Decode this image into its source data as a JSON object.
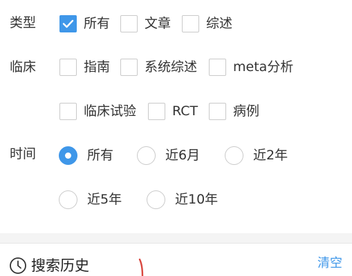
{
  "filters": {
    "type": {
      "label": "类型",
      "options": [
        {
          "label": "所有",
          "checked": true
        },
        {
          "label": "文章",
          "checked": false
        },
        {
          "label": "综述",
          "checked": false
        }
      ]
    },
    "clinical": {
      "label": "临床",
      "options": [
        {
          "label": "指南",
          "checked": false
        },
        {
          "label": "系统综述",
          "checked": false
        },
        {
          "label": "meta分析",
          "checked": false
        },
        {
          "label": "临床试验",
          "checked": false
        },
        {
          "label": "RCT",
          "checked": false
        },
        {
          "label": "病例",
          "checked": false
        }
      ]
    },
    "time": {
      "label": "时间",
      "options": [
        {
          "label": "所有",
          "selected": true
        },
        {
          "label": "近6月",
          "selected": false
        },
        {
          "label": "近2年",
          "selected": false
        },
        {
          "label": "近5年",
          "selected": false
        },
        {
          "label": "近10年",
          "selected": false
        }
      ]
    }
  },
  "history": {
    "title": "搜索历史",
    "clear_label": "清空",
    "icon": "clock-icon"
  },
  "colors": {
    "accent": "#3f97e9",
    "text": "#333333",
    "border": "#c9c9c9",
    "separator": "#f4f4f4",
    "annotation": "#d9473f"
  }
}
